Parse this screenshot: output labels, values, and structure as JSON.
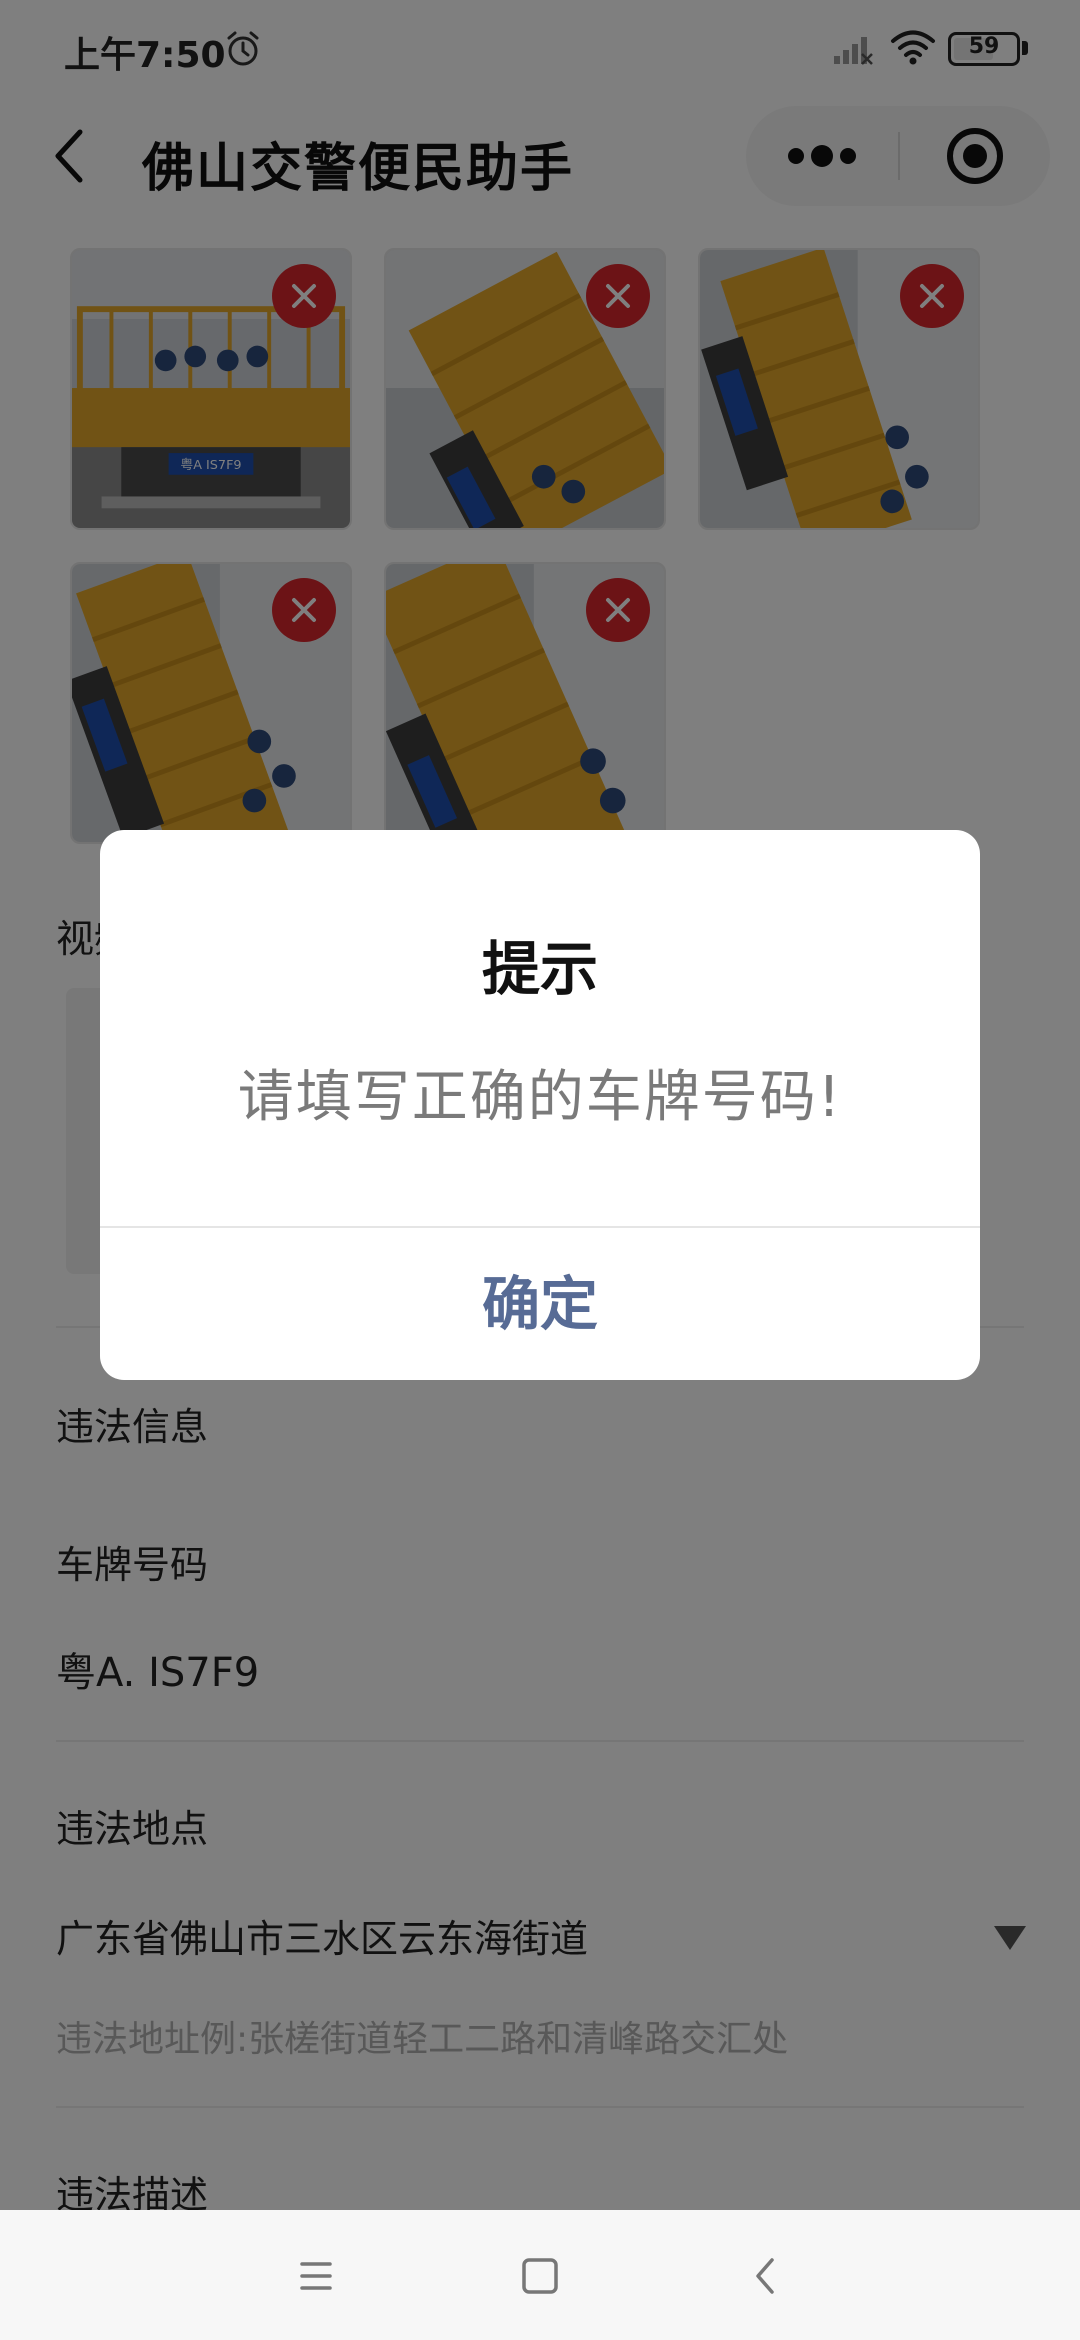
{
  "status_bar": {
    "time": "上午7:50",
    "battery": "59",
    "battery_level": 0.59
  },
  "nav": {
    "title": "佛山交警便民助手"
  },
  "photos": {
    "count": 5,
    "plate_text": "粤A IS7F9"
  },
  "form": {
    "video_label": "视频",
    "violation_info_label": "违法信息",
    "plate_label": "车牌号码",
    "plate_value": "粤A. IS7F9",
    "location_label": "违法地点",
    "location_value": "广东省佛山市三水区云东海街道",
    "location_hint": "违法地址例:张槎街道轻工二路和清峰路交汇处",
    "description_label": "违法描述"
  },
  "modal": {
    "title": "提示",
    "content": "请填写正确的车牌号码!",
    "confirm_label": "确定"
  },
  "colors": {
    "delete_badge": "#d9262c",
    "truck_yellow": "#e3a72a",
    "confirm_text": "#576b95"
  },
  "icons": {
    "alarm": "alarm-icon",
    "signal": "signal-icon",
    "wifi": "wifi-icon",
    "back": "back-arrow-icon",
    "more": "more-dots-icon",
    "close_app": "target-icon",
    "delete": "close-icon",
    "dropdown": "triangle-down-icon"
  }
}
